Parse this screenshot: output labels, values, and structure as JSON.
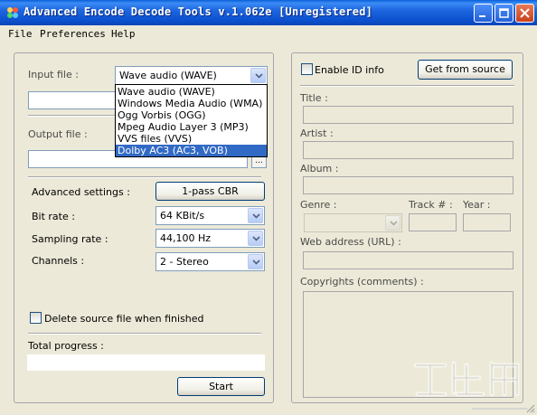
{
  "window": {
    "title": "Advanced Encode Decode Tools v.1.062e [Unregistered]",
    "title_icon": "app-icon"
  },
  "menu": {
    "items": [
      "File",
      "Preferences",
      "Help"
    ]
  },
  "left": {
    "input_file_label": "Input file :",
    "input_format_selected": "Wave audio (WAVE)",
    "input_file_value": "",
    "output_file_label": "Output file :",
    "output_file_value": "",
    "browse_label": "...",
    "format_options": [
      "Wave audio (WAVE)",
      "Windows Media Audio  (WMA)",
      "Ogg Vorbis (OGG)",
      "Mpeg Audio Layer 3 (MP3)",
      "VVS files (VVS)",
      "Dolby AC3 (AC3, VOB)"
    ],
    "format_highlighted_index": 5,
    "advanced_settings_label": "Advanced settings :",
    "advanced_settings_button": "1-pass CBR",
    "bit_rate_label": "Bit rate :",
    "bit_rate_value": "64 KBit/s",
    "sampling_rate_label": "Sampling rate :",
    "sampling_rate_value": "44,100 Hz",
    "channels_label": "Channels :",
    "channels_value": "2 - Stereo",
    "delete_source_label": "Delete source file when finished",
    "delete_source_checked": false,
    "total_progress_label": "Total progress :",
    "total_progress_fraction": 0,
    "start_button": "Start"
  },
  "right": {
    "enable_id_label": "Enable ID info",
    "enable_id_checked": false,
    "get_from_source_button": "Get from source",
    "title_label": "Title :",
    "artist_label": "Artist :",
    "album_label": "Album :",
    "genre_label": "Genre :",
    "track_label": "Track # :",
    "year_label": "Year :",
    "web_address_label": "Web address (URL) :",
    "copyrights_label": "Copyrights (comments) :"
  },
  "colors": {
    "titlebar": "#0c50cf",
    "selection": "#316ac5",
    "window_bg": "#ece9d8"
  }
}
